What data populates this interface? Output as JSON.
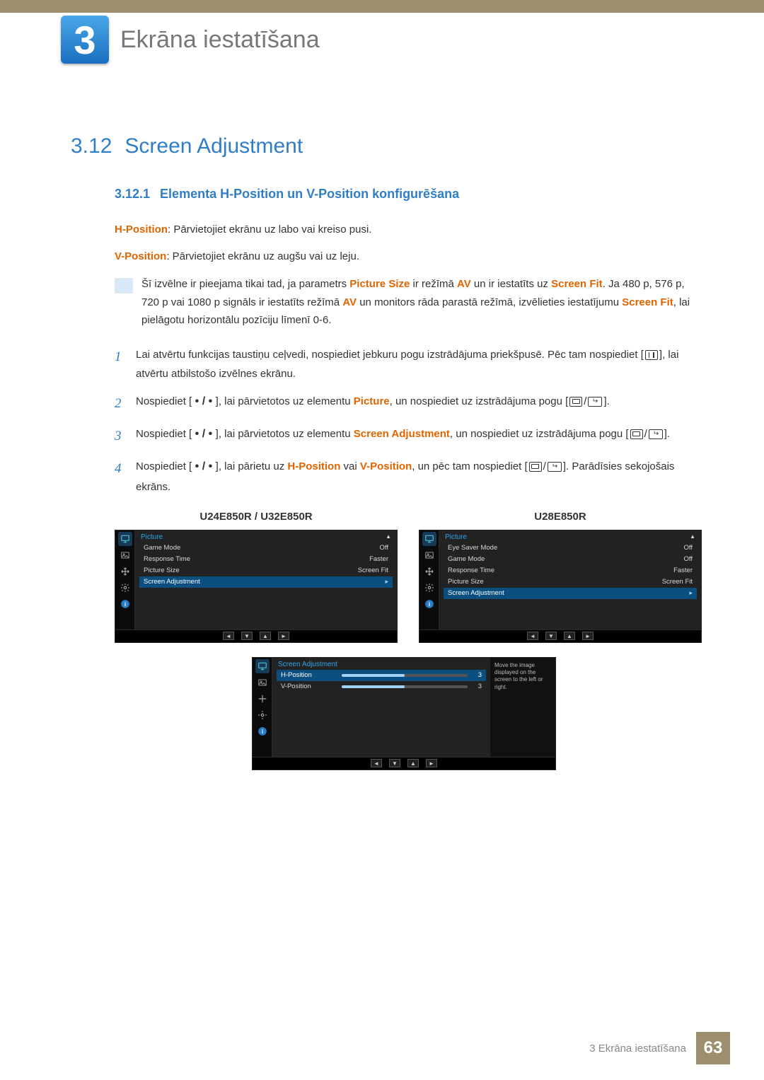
{
  "chapter": {
    "number": "3",
    "title": "Ekrāna iestatīšana"
  },
  "section": {
    "number": "3.12",
    "title": "Screen Adjustment"
  },
  "subsection": {
    "number": "3.12.1",
    "title": "Elementa H-Position un V-Position konfigurēšana"
  },
  "intro": {
    "hpos_label": "H-Position",
    "hpos_text": ": Pārvietojiet ekrānu uz labo vai kreiso pusi.",
    "vpos_label": "V-Position",
    "vpos_text": ": Pārvietojiet ekrānu uz augšu vai uz leju."
  },
  "note": {
    "pre": "Šī izvēlne ir pieejama tikai tad, ja parametrs ",
    "t1": "Picture Size",
    "mid1": " ir režīmā ",
    "t2": "AV",
    "mid2": " un ir iestatīts uz ",
    "t3": "Screen Fit",
    "mid3": ". Ja 480 p, 576 p, 720 p vai 1080 p signāls ir iestatīts režīmā ",
    "t4": "AV",
    "mid4": " un monitors rāda parastā režīmā, izvēlieties iestatījumu ",
    "t5": "Screen Fit",
    "post": ", lai pielāgotu horizontālu pozīciju līmenī 0-6."
  },
  "steps": {
    "s1a": "Lai atvērtu funkcijas taustiņu ceļvedi, nospiediet jebkuru pogu izstrādājuma priekšpusē. Pēc tam nospiediet [",
    "s1b": "], lai atvērtu atbilstošo izvēlnes ekrānu.",
    "s2a": "Nospiediet [",
    "s2b": "], lai pārvietotos uz elementu ",
    "s2_kw": "Picture",
    "s2c": ", un nospiediet uz izstrādājuma pogu [",
    "s2d": "].",
    "s3a": "Nospiediet [",
    "s3b": "], lai pārvietotos uz elementu ",
    "s3_kw": "Screen Adjustment",
    "s3c": ", un nospiediet uz izstrādājuma pogu [",
    "s3d": "].",
    "s4a": "Nospiediet [",
    "s4b": "], lai pārietu uz ",
    "s4_kw1": "H-Position",
    "s4_mid": " vai ",
    "s4_kw2": "V-Position",
    "s4c": ", un pēc tam nospiediet [",
    "s4d": "]. Parādīsies sekojošais ekrāns.",
    "dot_sep": " • / • "
  },
  "screens": {
    "left_label": "U24E850R / U32E850R",
    "right_label": "U28E850R",
    "menu1": {
      "title": "Picture",
      "items": [
        {
          "label": "Game Mode",
          "value": "Off"
        },
        {
          "label": "Response Time",
          "value": "Faster"
        },
        {
          "label": "Picture Size",
          "value": "Screen Fit"
        },
        {
          "label": "Screen Adjustment",
          "value": "▸",
          "selected": true
        }
      ]
    },
    "menu2": {
      "title": "Picture",
      "items": [
        {
          "label": "Eye Saver Mode",
          "value": "Off"
        },
        {
          "label": "Game Mode",
          "value": "Off"
        },
        {
          "label": "Response Time",
          "value": "Faster"
        },
        {
          "label": "Picture Size",
          "value": "Screen Fit"
        },
        {
          "label": "Screen Adjustment",
          "value": "▸",
          "selected": true
        }
      ]
    },
    "menu3": {
      "title": "Screen Adjustment",
      "help": "Move the image displayed on the screen to the left or right.",
      "items": [
        {
          "label": "H-Position",
          "value": "3",
          "fill": 50,
          "selected": true
        },
        {
          "label": "V-Position",
          "value": "3",
          "fill": 50
        }
      ]
    },
    "nav": {
      "left": "◄",
      "down": "▼",
      "up": "▲",
      "right": "►"
    }
  },
  "footer": {
    "text": "3 Ekrāna iestatīšana",
    "page": "63"
  }
}
